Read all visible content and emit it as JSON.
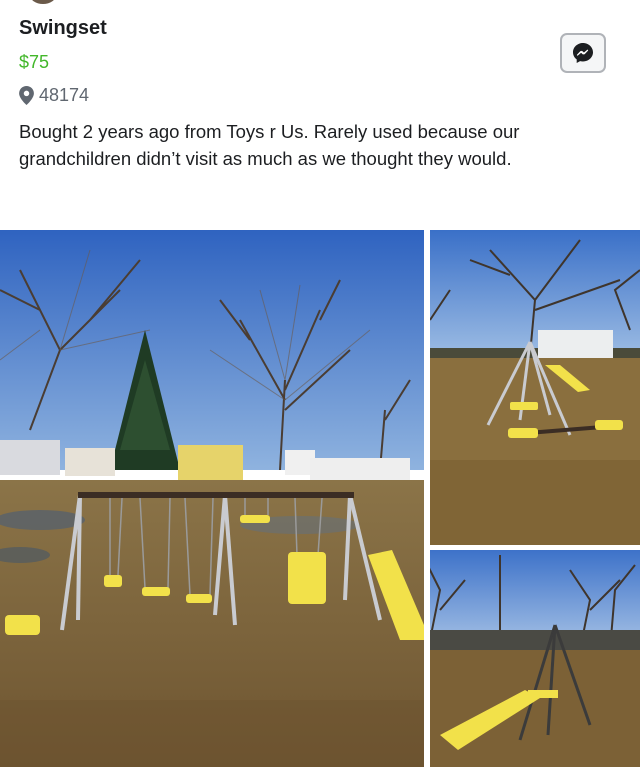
{
  "listing": {
    "title": "Swingset",
    "price": "$75",
    "location": "48174",
    "description": "Bought 2 years ago from Toys r Us. Rarely used because our grandchildren didn’t visit as much as we thought they would."
  },
  "icons": {
    "location": "location-pin-icon",
    "message": "messenger-icon"
  },
  "colors": {
    "price": "#42b72a",
    "sky": "#3b74c9",
    "grass": "#8a6f3e",
    "swing_yellow": "#f2e14a"
  }
}
